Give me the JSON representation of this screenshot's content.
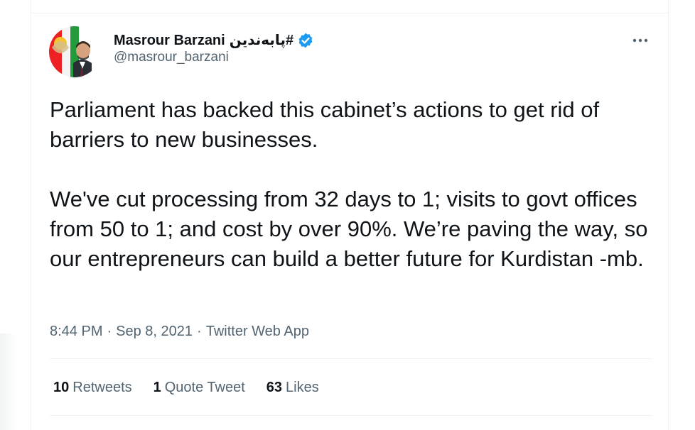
{
  "tweet": {
    "author": {
      "display_name": "Masrour Barzani",
      "hashtag": "#پابەندین",
      "handle": "@masrour_barzani",
      "verified": true,
      "verified_color": "#1d9bf0"
    },
    "text": "Parliament has backed this cabinet’s actions to get rid of barriers to new businesses.\n\nWe've cut processing from 32 days to 1; visits to govt offices from 50 to 1; and cost by over 90%. We’re paving the way, so our entrepreneurs can build a better future for Kurdistan -mb.",
    "time": "8:44 PM",
    "separator": "·",
    "date": "Sep 8, 2021",
    "source": "Twitter Web App",
    "stats": {
      "retweets_count": "10",
      "retweets_label": "Retweets",
      "quotes_count": "1",
      "quotes_label": "Quote Tweet",
      "likes_count": "63",
      "likes_label": "Likes"
    }
  },
  "icons": {
    "more": "more-horizontal-icon",
    "verified": "verified-badge-icon"
  },
  "colors": {
    "text": "#0f1419",
    "secondary": "#536471",
    "divider": "#eff3f4",
    "accent": "#1d9bf0"
  }
}
